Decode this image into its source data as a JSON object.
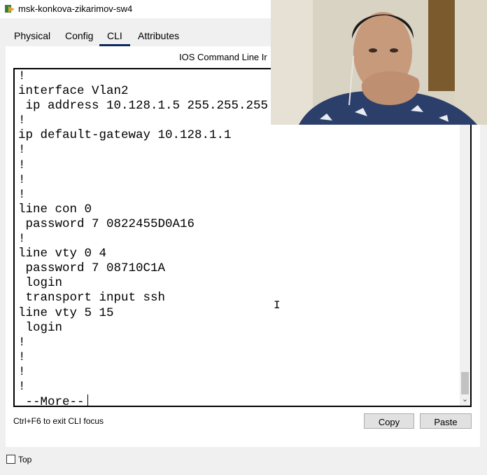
{
  "window": {
    "title": "msk-konkova-zikarimov-sw4"
  },
  "tabs": [
    {
      "label": "Physical"
    },
    {
      "label": "Config"
    },
    {
      "label": "CLI"
    },
    {
      "label": "Attributes"
    }
  ],
  "cli": {
    "header": "IOS Command Line Ir",
    "lines": [
      "!",
      "interface Vlan2",
      " ip address 10.128.1.5 255.255.255",
      "!",
      "ip default-gateway 10.128.1.1",
      "!",
      "!",
      "!",
      "!",
      "line con 0",
      " password 7 0822455D0A16",
      "!",
      "line vty 0 4",
      " password 7 08710C1A",
      " login",
      " transport input ssh",
      "line vty 5 15",
      " login",
      "!",
      "!",
      "!",
      "!",
      " --More--"
    ]
  },
  "footer": {
    "exit_hint": "Ctrl+F6 to exit CLI focus",
    "copy_label": "Copy",
    "paste_label": "Paste"
  },
  "top_checkbox": {
    "label": "Top",
    "checked": false
  }
}
